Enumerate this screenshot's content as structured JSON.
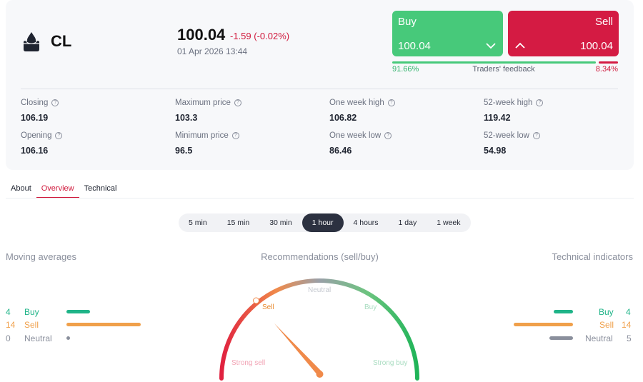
{
  "instrument": {
    "symbol": "CL",
    "price": "100.04",
    "change": "-1.59 (-0.02%)",
    "datetime": "01 Apr 2026 13:44",
    "logo_icon": "oil-drop-icon"
  },
  "trade": {
    "buy_label": "Buy",
    "buy_price": "100.04",
    "sell_label": "Sell",
    "sell_price": "100.04",
    "feedback_label": "Traders' feedback",
    "buy_percent": "91.66%",
    "sell_percent": "8.34%",
    "buy_share": 0.9166,
    "colors": {
      "buy": "#47c97a",
      "sell": "#d41b43"
    }
  },
  "stats": [
    {
      "label": "Closing",
      "value": "106.19"
    },
    {
      "label": "Maximum price",
      "value": "103.3"
    },
    {
      "label": "One week high",
      "value": "106.82"
    },
    {
      "label": "52-week high",
      "value": "119.42"
    },
    {
      "label": "Opening",
      "value": "106.16"
    },
    {
      "label": "Minimum price",
      "value": "96.5"
    },
    {
      "label": "One week low",
      "value": "86.46"
    },
    {
      "label": "52-week low",
      "value": "54.98"
    }
  ],
  "tabs": [
    {
      "label": "About"
    },
    {
      "label": "Overview",
      "active": true
    },
    {
      "label": "Technical"
    }
  ],
  "periods": [
    {
      "label": "5 min"
    },
    {
      "label": "15 min"
    },
    {
      "label": "30 min"
    },
    {
      "label": "1 hour",
      "active": true
    },
    {
      "label": "4 hours"
    },
    {
      "label": "1 day"
    },
    {
      "label": "1 week"
    }
  ],
  "moving_averages": {
    "title": "Moving averages",
    "rows": [
      {
        "count": "4",
        "label": "Buy",
        "color": "#1fb488"
      },
      {
        "count": "14",
        "label": "Sell",
        "color": "#f0a04b"
      },
      {
        "count": "0",
        "label": "Neutral",
        "color": "#8a8f9c"
      }
    ]
  },
  "recommendations": {
    "title": "Recommendations (sell/buy)",
    "labels": {
      "strong_sell": "Strong sell",
      "sell": "Sell",
      "neutral": "Neutral",
      "buy": "Buy",
      "strong_buy": "Strong buy"
    },
    "active": "sell"
  },
  "technical_indicators": {
    "title": "Technical indicators",
    "rows": [
      {
        "count": "4",
        "label": "Buy",
        "color": "#1fb488"
      },
      {
        "count": "14",
        "label": "Sell",
        "color": "#f0a04b"
      },
      {
        "count": "5",
        "label": "Neutral",
        "color": "#8a8f9c"
      }
    ]
  }
}
